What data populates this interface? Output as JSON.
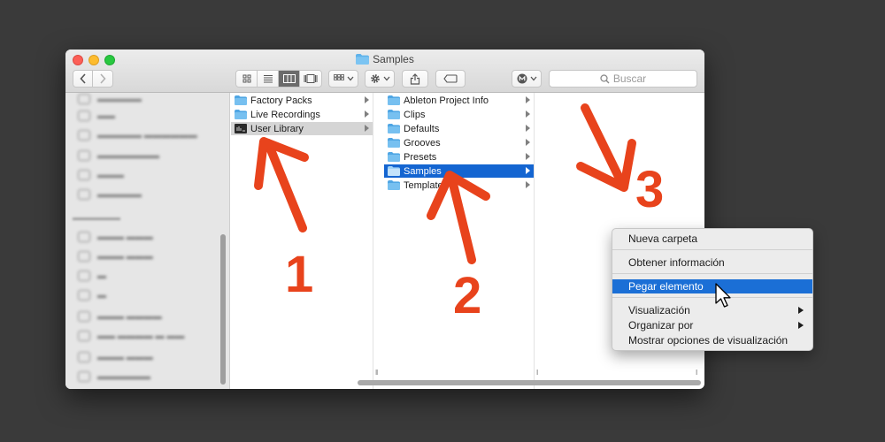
{
  "window": {
    "title": "Samples",
    "colors": {
      "selection_blue": "#1465d1",
      "annotation_red": "#e8431c"
    }
  },
  "toolbar": {
    "back_icon": "chevron-left-icon",
    "forward_icon": "chevron-right-icon",
    "view_modes": [
      "icon-view-icon",
      "list-view-icon",
      "column-view-icon",
      "gallery-view-icon"
    ],
    "active_view": "column-view-icon",
    "group_icon": "group-grid-icon",
    "action_icon": "gear-icon",
    "share_icon": "share-icon",
    "tag_icon": "tag-icon",
    "account_icon": "account-m-icon",
    "search_placeholder": "Buscar"
  },
  "columns": [
    {
      "items": [
        {
          "name": "Factory Packs",
          "icon": "folder-icon",
          "selected": "none"
        },
        {
          "name": "Live Recordings",
          "icon": "folder-icon",
          "selected": "none"
        },
        {
          "name": "User Library",
          "icon": "ableton-library-icon",
          "selected": "grey"
        }
      ]
    },
    {
      "items": [
        {
          "name": "Ableton Project Info",
          "icon": "folder-icon",
          "selected": "none"
        },
        {
          "name": "Clips",
          "icon": "folder-icon",
          "selected": "none"
        },
        {
          "name": "Defaults",
          "icon": "folder-icon",
          "selected": "none"
        },
        {
          "name": "Grooves",
          "icon": "folder-icon",
          "selected": "none"
        },
        {
          "name": "Presets",
          "icon": "folder-icon",
          "selected": "none"
        },
        {
          "name": "Samples",
          "icon": "folder-icon",
          "selected": "blue"
        },
        {
          "name": "Templates",
          "icon": "folder-icon",
          "selected": "none"
        }
      ]
    }
  ],
  "context_menu": {
    "items": [
      {
        "label": "Nueva carpeta"
      },
      {
        "label": "Obtener información"
      },
      {
        "label": "Pegar elemento",
        "highlighted": true
      },
      {
        "label": "Visualización",
        "submenu": true
      },
      {
        "label": "Organizar por",
        "submenu": true
      },
      {
        "label": "Mostrar opciones de visualización"
      }
    ]
  },
  "annotations": {
    "step1": "1",
    "step2": "2",
    "step3": "3"
  }
}
